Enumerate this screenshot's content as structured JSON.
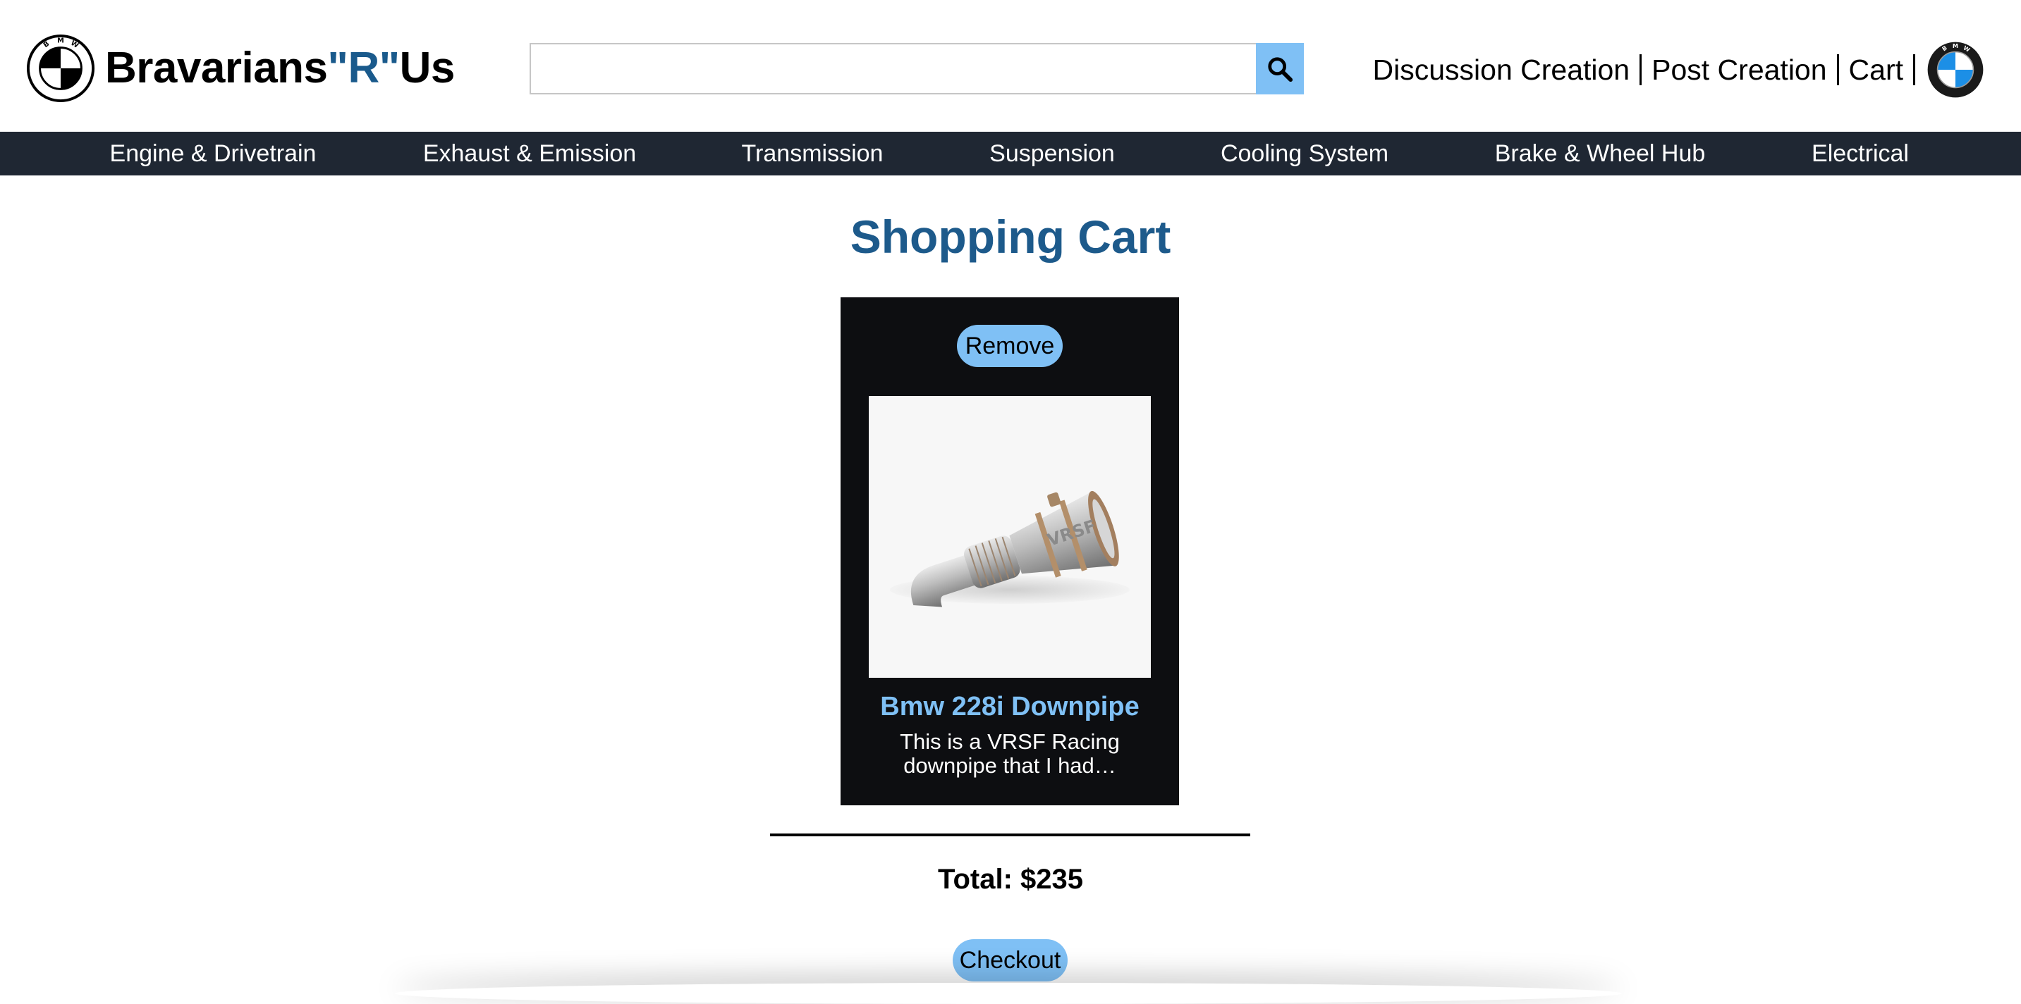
{
  "header": {
    "brand": {
      "name_main": "Bravarians",
      "name_accent": "\"R\"",
      "name_end": "Us",
      "logo_icon": "bmw-roundel-outline-icon"
    },
    "search": {
      "value": "",
      "placeholder": "",
      "button_icon": "search-icon"
    },
    "links": [
      "Discussion Creation",
      "Post Creation",
      "Cart"
    ],
    "avatar_icon": "bmw-roundel-icon"
  },
  "nav": {
    "items": [
      "Engine & Drivetrain",
      "Exhaust & Emission",
      "Transmission",
      "Suspension",
      "Cooling System",
      "Brake & Wheel Hub",
      "Electrical"
    ]
  },
  "main": {
    "title": "Shopping Cart",
    "cart_items": [
      {
        "remove_label": "Remove",
        "title": "Bmw 228i Downpipe",
        "description": "This is a VRSF Racing downpipe that I had…",
        "image_icon": "downpipe-image",
        "image_text": "VRSF"
      }
    ],
    "total": "Total: $235",
    "checkout_label": "Checkout"
  },
  "colors": {
    "accent": "#7fc0f5",
    "brand_blue": "#1a5a8c",
    "nav_bg": "#1f2733",
    "card_bg": "#0d0e11"
  }
}
